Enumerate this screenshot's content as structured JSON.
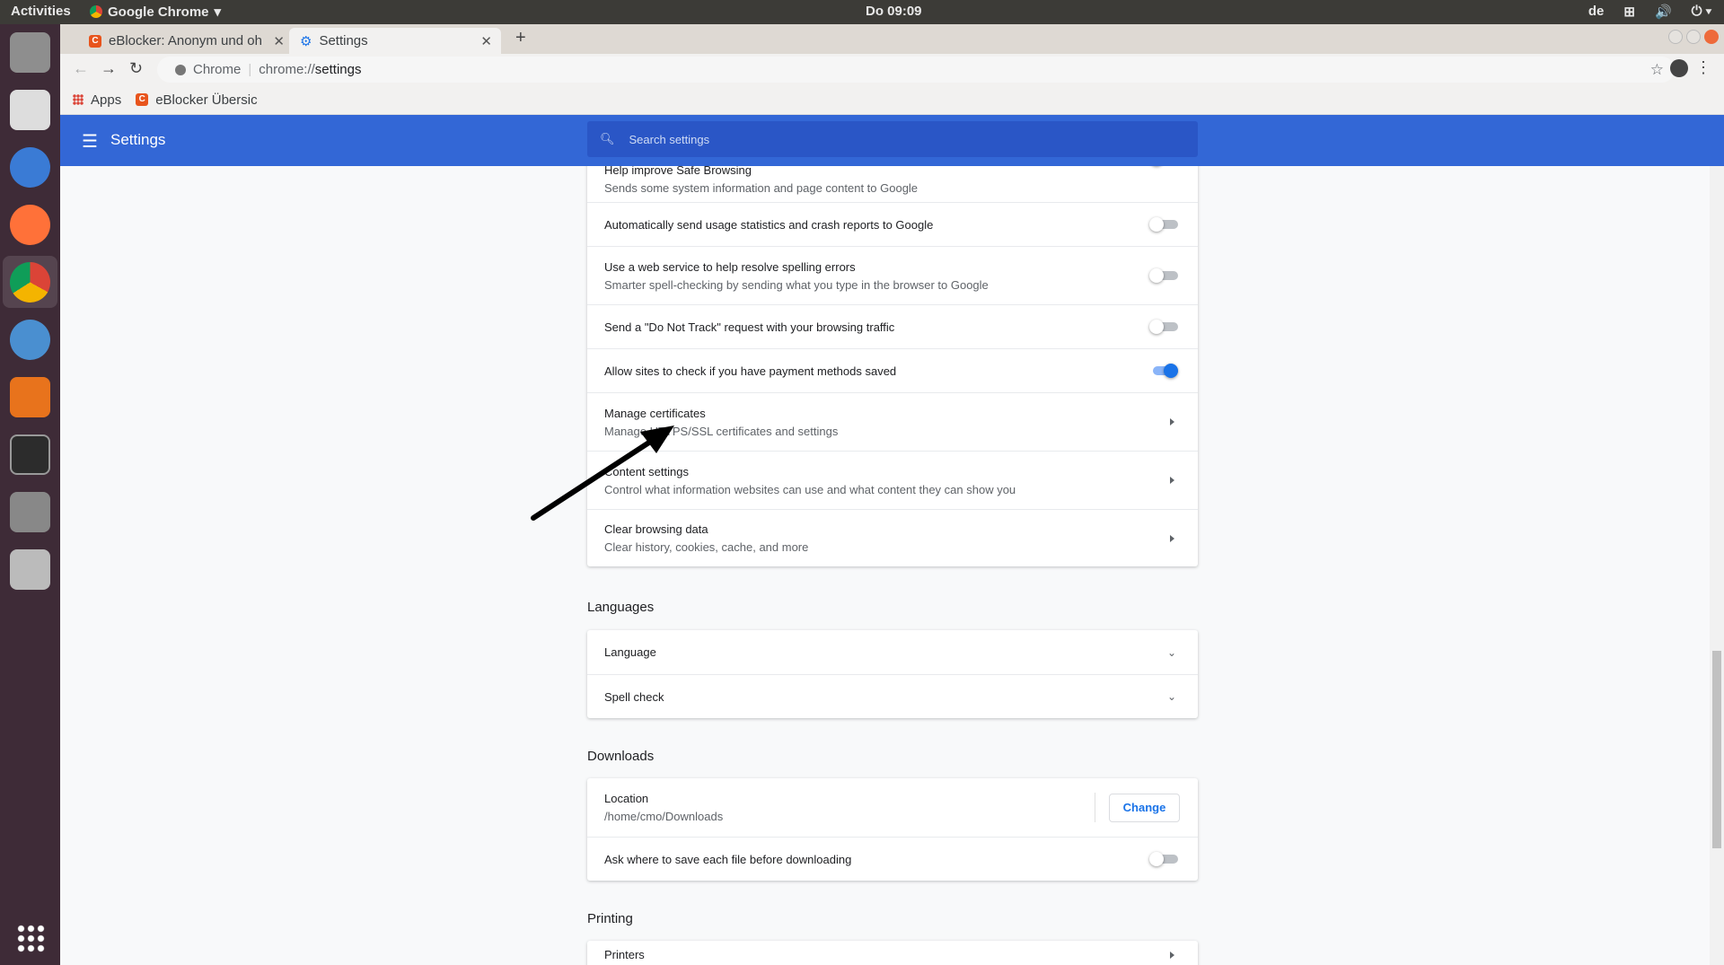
{
  "system": {
    "activities": "Activities",
    "app_name": "Google Chrome",
    "clock": "Do 09:09",
    "keyboard": "de"
  },
  "tabs": [
    {
      "label": "eBlocker: Anonym und oh",
      "icon": "eblocker-icon"
    },
    {
      "label": "Settings",
      "icon": "gear-icon"
    }
  ],
  "toolbar": {
    "site_label": "Chrome",
    "url_prefix": "chrome://",
    "url_path": "settings"
  },
  "bookmarks": [
    {
      "label": "Apps"
    },
    {
      "label": "eBlocker Übersic"
    }
  ],
  "header": {
    "title": "Settings",
    "search_placeholder": "Search settings",
    "color": "#3367d6"
  },
  "privacy_rows": [
    {
      "title": "Help improve Safe Browsing",
      "sub": "Sends some system information and page content to Google",
      "control": "toggle",
      "on": false
    },
    {
      "title": "Automatically send usage statistics and crash reports to Google",
      "sub": "",
      "control": "toggle",
      "on": false
    },
    {
      "title": "Use a web service to help resolve spelling errors",
      "sub": "Smarter spell-checking by sending what you type in the browser to Google",
      "control": "toggle",
      "on": false
    },
    {
      "title": "Send a \"Do Not Track\" request with your browsing traffic",
      "sub": "",
      "control": "toggle",
      "on": false
    },
    {
      "title": "Allow sites to check if you have payment methods saved",
      "sub": "",
      "control": "toggle",
      "on": true
    },
    {
      "title": "Manage certificates",
      "sub": "Manage HTTPS/SSL certificates and settings",
      "control": "arrow"
    },
    {
      "title": "Content settings",
      "sub": "Control what information websites can use and what content they can show you",
      "control": "arrow"
    },
    {
      "title": "Clear browsing data",
      "sub": "Clear history, cookies, cache, and more",
      "control": "arrow"
    }
  ],
  "languages": {
    "heading": "Languages",
    "rows": [
      {
        "title": "Language"
      },
      {
        "title": "Spell check"
      }
    ]
  },
  "downloads": {
    "heading": "Downloads",
    "location_label": "Location",
    "location_value": "/home/cmo/Downloads",
    "change_label": "Change",
    "ask_label": "Ask where to save each file before downloading",
    "ask_on": false
  },
  "printing": {
    "heading": "Printing",
    "rows": [
      {
        "title": "Printers"
      }
    ]
  }
}
